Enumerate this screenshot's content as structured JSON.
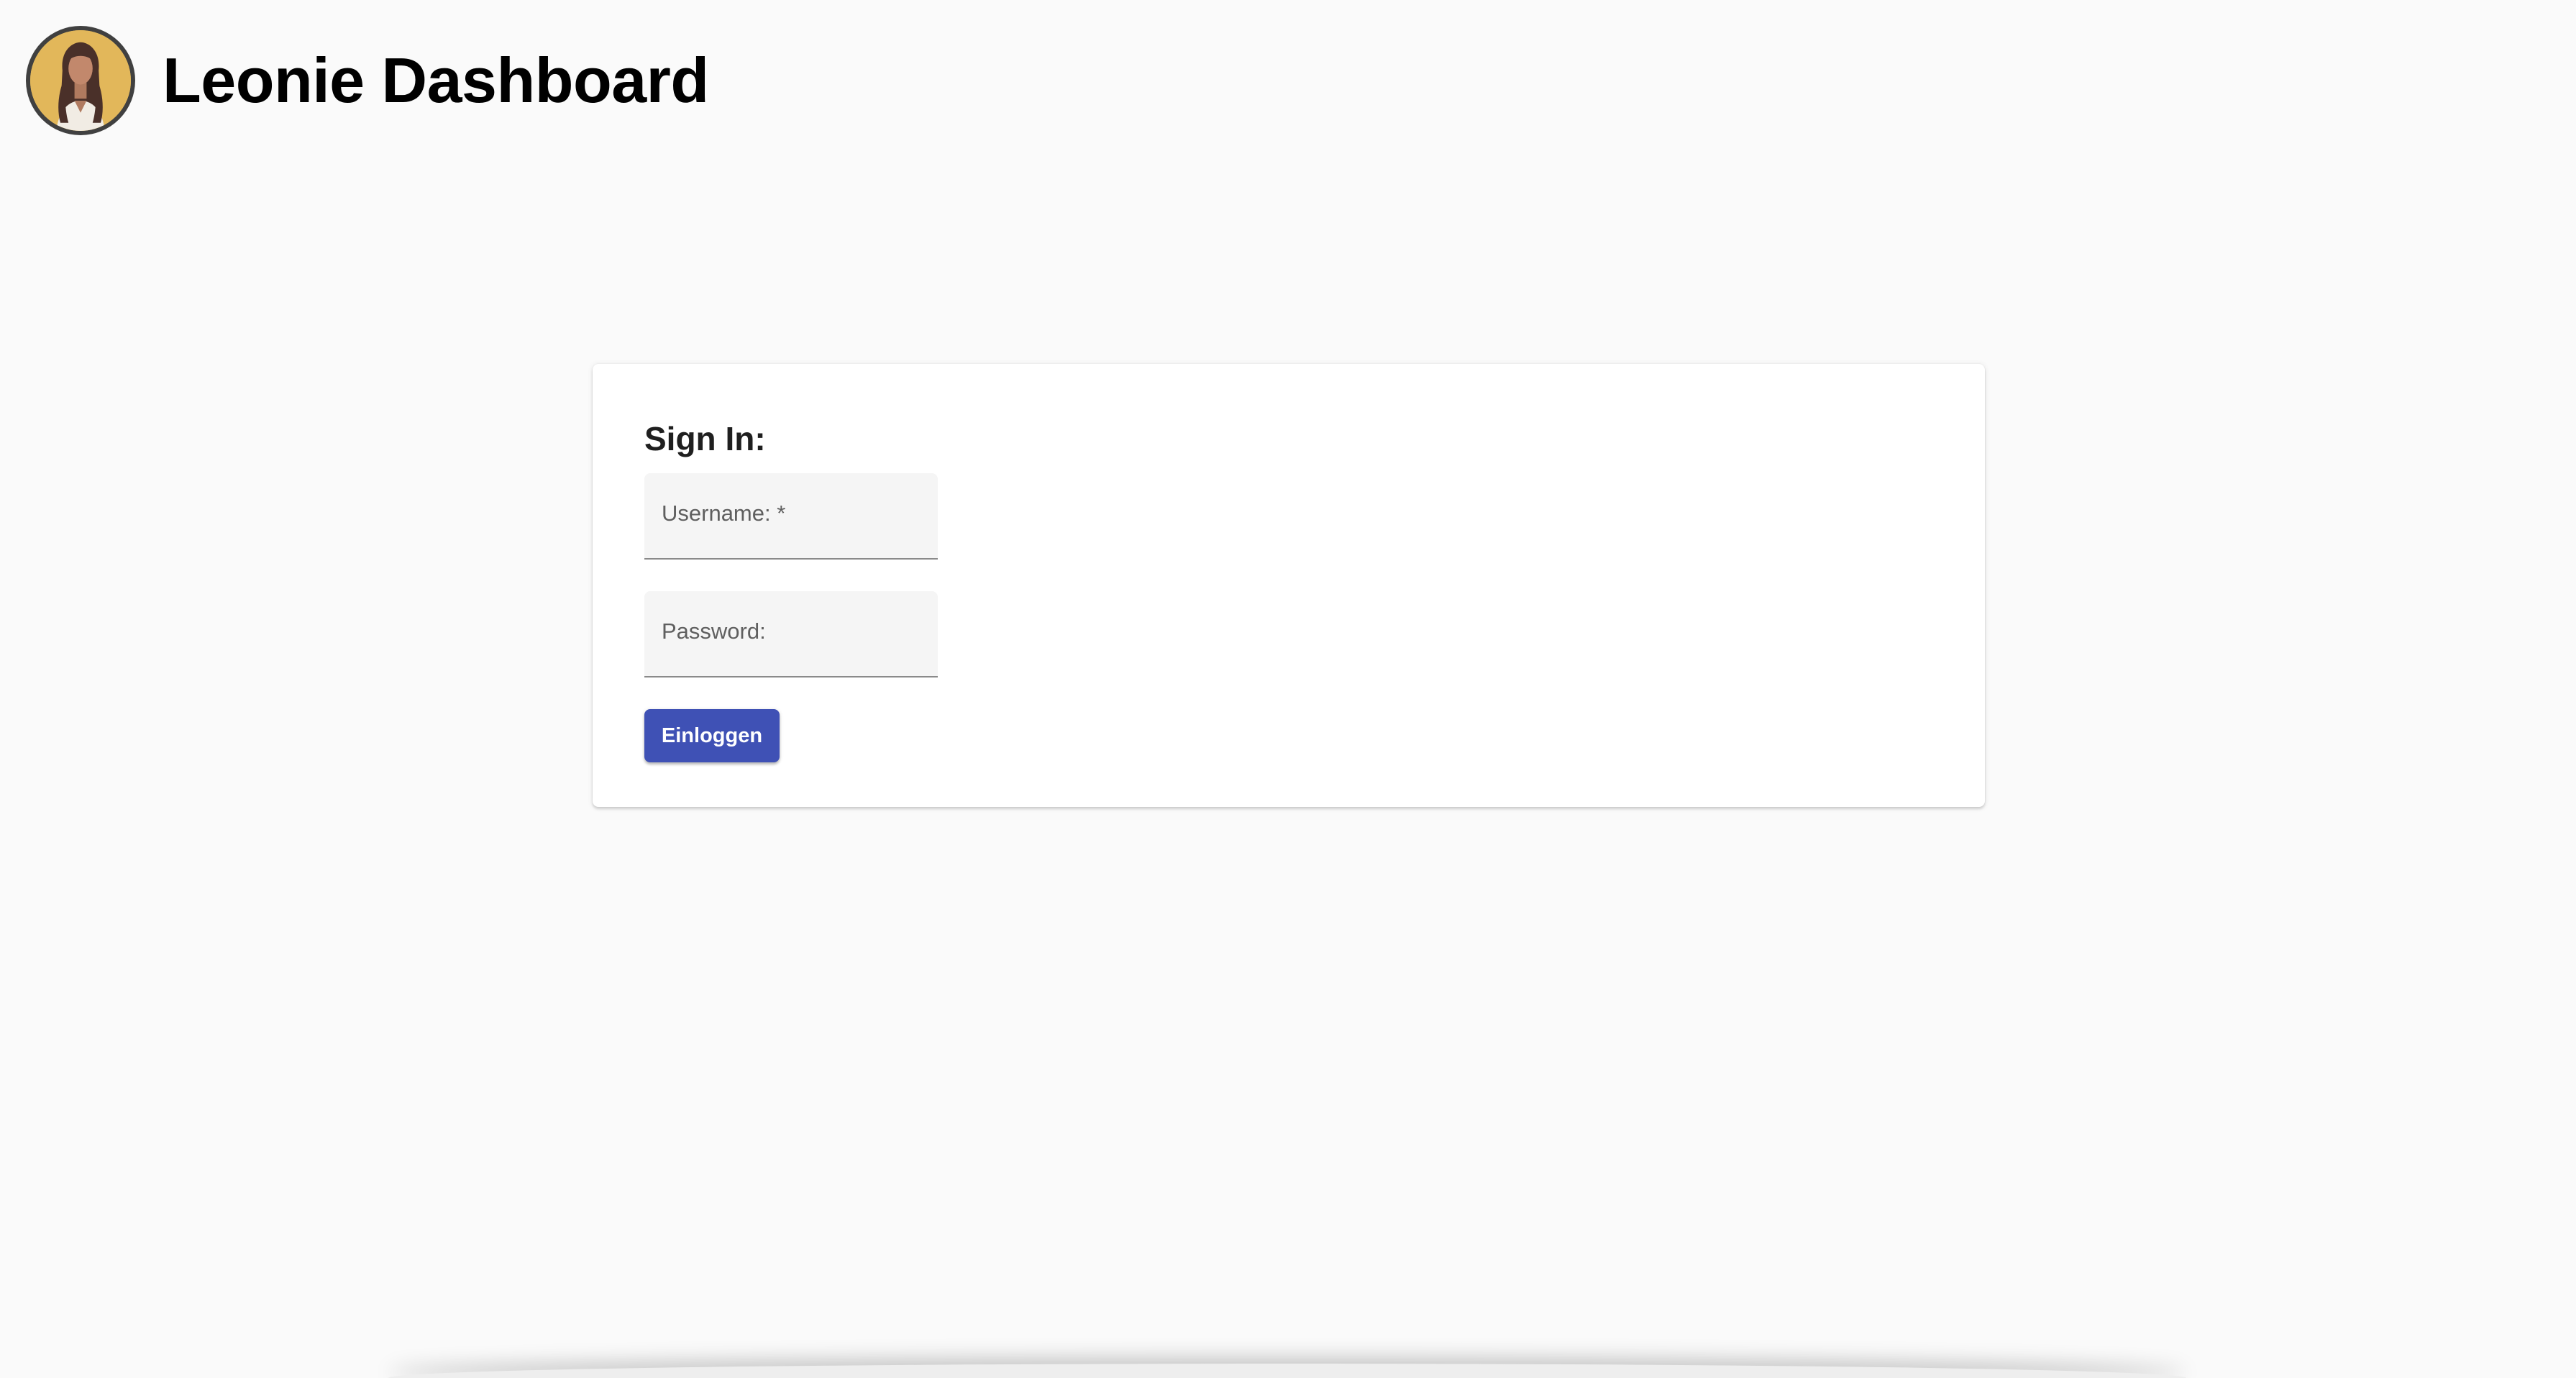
{
  "header": {
    "title": "Leonie Dashboard",
    "avatar_icon": "woman-portrait-avatar",
    "avatar_bg_color": "#e2b75a"
  },
  "login": {
    "title": "Sign In:",
    "username_label": "Username: *",
    "username_value": "",
    "password_label": "Password:",
    "password_value": "",
    "submit_label": "Einloggen",
    "accent_color": "#3f51b5"
  }
}
